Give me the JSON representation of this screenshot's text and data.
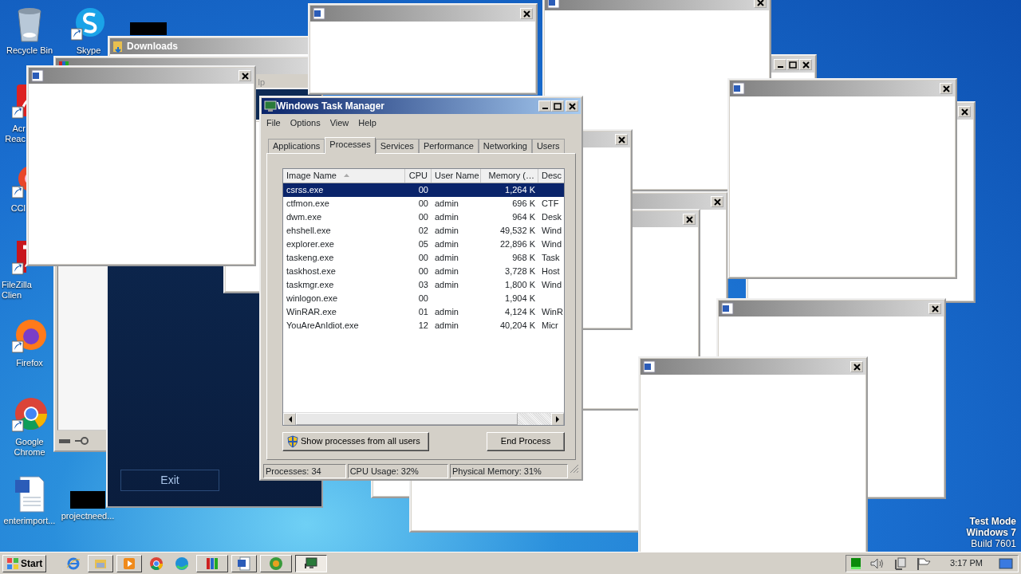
{
  "desktop_icons": [
    {
      "kind": "recycle",
      "label": "Recycle Bin"
    },
    {
      "kind": "skype",
      "label": "Skype"
    },
    {
      "kind": "acrobat",
      "label": "Acr Reac"
    },
    {
      "kind": "ccleaner",
      "label": "CCl"
    },
    {
      "kind": "filezilla",
      "label": "FileZilla Clien"
    },
    {
      "kind": "firefox",
      "label": "Firefox"
    },
    {
      "kind": "chrome",
      "label": "Google Chrome"
    },
    {
      "kind": "word",
      "label": "enterimport..."
    },
    {
      "kind": "hidden",
      "label": "projectneed..."
    }
  ],
  "downloads_window": {
    "title": "Downloads"
  },
  "archive_window": {
    "menu_fragment": "lp"
  },
  "app_window": {
    "button": "Exit"
  },
  "task_manager": {
    "title": "Windows Task Manager",
    "menu": [
      "File",
      "Options",
      "View",
      "Help"
    ],
    "tabs": [
      {
        "label": "Applications",
        "selected": false
      },
      {
        "label": "Processes",
        "selected": true
      },
      {
        "label": "Services",
        "selected": false
      },
      {
        "label": "Performance",
        "selected": false
      },
      {
        "label": "Networking",
        "selected": false
      },
      {
        "label": "Users",
        "selected": false
      }
    ],
    "columns": [
      {
        "label": "Image Name",
        "sorted": true
      },
      {
        "label": "CPU",
        "sorted": false
      },
      {
        "label": "User Name",
        "sorted": false
      },
      {
        "label": "Memory (…",
        "sorted": false
      },
      {
        "label": "Desc",
        "sorted": false
      }
    ],
    "rows": [
      {
        "image_name": "csrss.exe",
        "cpu": "00",
        "memory": "1,264 K",
        "selected": true
      },
      {
        "image_name": "ctfmon.exe",
        "cpu": "00",
        "user_name": "admin",
        "memory": "696 K",
        "description": "CTF",
        "selected": false
      },
      {
        "image_name": "dwm.exe",
        "cpu": "00",
        "user_name": "admin",
        "memory": "964 K",
        "description": "Desk",
        "selected": false
      },
      {
        "image_name": "ehshell.exe",
        "cpu": "02",
        "user_name": "admin",
        "memory": "49,532 K",
        "description": "Wind",
        "selected": false
      },
      {
        "image_name": "explorer.exe",
        "cpu": "05",
        "user_name": "admin",
        "memory": "22,896 K",
        "description": "Wind",
        "selected": false
      },
      {
        "image_name": "taskeng.exe",
        "cpu": "00",
        "user_name": "admin",
        "memory": "968 K",
        "description": "Task",
        "selected": false
      },
      {
        "image_name": "taskhost.exe",
        "cpu": "00",
        "user_name": "admin",
        "memory": "3,728 K",
        "description": "Host",
        "selected": false
      },
      {
        "image_name": "taskmgr.exe",
        "cpu": "03",
        "user_name": "admin",
        "memory": "1,800 K",
        "description": "Wind",
        "selected": false
      },
      {
        "image_name": "winlogon.exe",
        "cpu": "00",
        "memory": "1,904 K",
        "selected": false
      },
      {
        "image_name": "WinRAR.exe",
        "cpu": "01",
        "user_name": "admin",
        "memory": "4,124 K",
        "description": "WinR",
        "selected": false
      },
      {
        "image_name": "YouAreAnIdiot.exe",
        "cpu": "12",
        "user_name": "admin",
        "memory": "40,204 K",
        "description": "Micr",
        "selected": false
      }
    ],
    "buttons": [
      {
        "kind": "shield",
        "label": "Show processes from all users"
      },
      {
        "kind": "plain",
        "label": "End Process"
      }
    ],
    "status_bar": [
      "Processes: 34",
      "CPU Usage: 32%",
      "Physical Memory: 31%"
    ]
  },
  "os_notice": [
    "Test Mode",
    "Windows 7",
    "Build 7601"
  ],
  "taskbar": {
    "start": "Start",
    "buttons": [
      {
        "kind": "ie",
        "active": false
      },
      {
        "kind": "folder",
        "active": false
      },
      {
        "kind": "media",
        "active": false
      },
      {
        "kind": "chrome",
        "active": false
      },
      {
        "kind": "edge",
        "active": false
      },
      {
        "kind": "winrar",
        "active": false
      },
      {
        "kind": "word",
        "active": false
      },
      {
        "kind": "wmp",
        "active": false
      },
      {
        "kind": "taskmgr",
        "active": true
      }
    ],
    "clock": "3:17 PM"
  }
}
